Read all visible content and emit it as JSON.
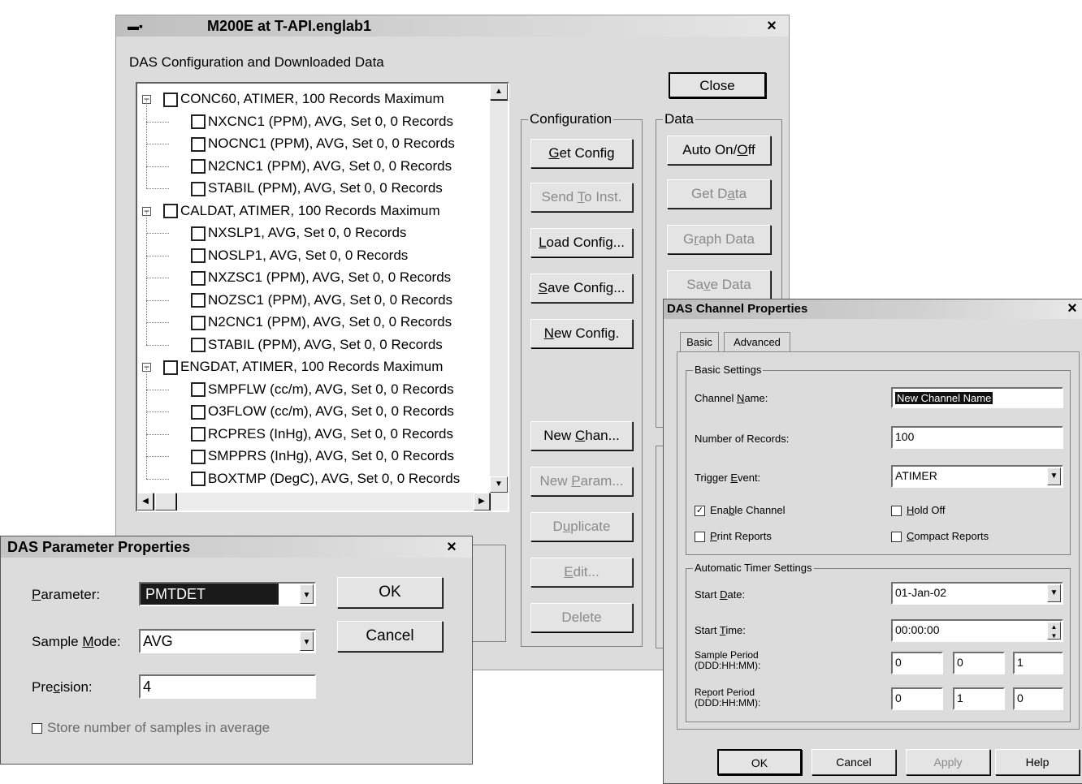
{
  "main": {
    "title": "M200E  at T-API.englab1",
    "subtitle": "DAS Configuration and Downloaded Data",
    "close_x": "×",
    "close_label": "Close",
    "tree": [
      {
        "label": "CONC60, ATIMER, 100 Records Maximum",
        "level": 0
      },
      {
        "label": "NXCNC1 (PPM), AVG, Set 0, 0 Records",
        "level": 1
      },
      {
        "label": "NOCNC1 (PPM), AVG, Set 0, 0 Records",
        "level": 1
      },
      {
        "label": "N2CNC1 (PPM), AVG, Set 0, 0 Records",
        "level": 1
      },
      {
        "label": "STABIL (PPM), AVG, Set 0, 0 Records",
        "level": 1
      },
      {
        "label": "CALDAT, ATIMER, 100 Records Maximum",
        "level": 0
      },
      {
        "label": "NXSLP1, AVG, Set 0, 0 Records",
        "level": 1
      },
      {
        "label": "NOSLP1, AVG, Set 0, 0 Records",
        "level": 1
      },
      {
        "label": "NXZSC1 (PPM), AVG, Set 0, 0 Records",
        "level": 1
      },
      {
        "label": "NOZSC1 (PPM), AVG, Set 0, 0 Records",
        "level": 1
      },
      {
        "label": "N2CNC1 (PPM), AVG, Set 0, 0 Records",
        "level": 1
      },
      {
        "label": "STABIL (PPM), AVG, Set 0, 0 Records",
        "level": 1
      },
      {
        "label": "ENGDAT, ATIMER, 100 Records Maximum",
        "level": 0
      },
      {
        "label": "SMPFLW (cc/m), AVG, Set 0, 0 Records",
        "level": 1
      },
      {
        "label": "O3FLOW (cc/m), AVG, Set 0, 0 Records",
        "level": 1
      },
      {
        "label": "RCPRES (InHg), AVG, Set 0, 0 Records",
        "level": 1
      },
      {
        "label": "SMPPRS (InHg), AVG, Set 0, 0 Records",
        "level": 1
      },
      {
        "label": "BOXTMP (DegC), AVG, Set 0, 0 Records",
        "level": 1
      }
    ],
    "configuration": {
      "label": "Configuration",
      "get_config": "Get Config",
      "send_to_inst": "Send To Inst.",
      "load_config": "Load Config...",
      "save_config": "Save Config...",
      "new_config": "New Config.",
      "new_chan": "New Chan...",
      "new_param": "New Param...",
      "duplicate": "Duplicate",
      "edit": "Edit...",
      "delete": "Delete"
    },
    "data": {
      "label": "Data",
      "auto_onoff": "Auto On/Off",
      "get_data": "Get Data",
      "graph_data": "Graph Data",
      "save_data": "Save Data"
    }
  },
  "param_dialog": {
    "title": "DAS Parameter Properties",
    "close_x": "×",
    "parameter_label": "Parameter:",
    "parameter_value": "PMTDET",
    "sample_mode_label": "Sample Mode:",
    "sample_mode_value": "AVG",
    "precision_label": "Precision:",
    "precision_value": "4",
    "store_samples_label": "Store number of samples in average",
    "ok": "OK",
    "cancel": "Cancel"
  },
  "channel_dialog": {
    "title": "DAS Channel Properties",
    "close_x": "×",
    "tabs": [
      "Basic",
      "Advanced"
    ],
    "basic_settings_label": "Basic Settings",
    "channel_name_label": "Channel Name:",
    "channel_name_value": "New Channel Name",
    "num_records_label": "Number of Records:",
    "num_records_value": "100",
    "trigger_event_label": "Trigger Event:",
    "trigger_event_value": "ATIMER",
    "enable_channel_label": "Enable Channel",
    "enable_channel_checked": true,
    "hold_off_label": "Hold Off",
    "print_reports_label": "Print Reports",
    "compact_reports_label": "Compact Reports",
    "timer_settings_label": "Automatic Timer Settings",
    "start_date_label": "Start Date:",
    "start_date_value": "01-Jan-02",
    "start_time_label": "Start Time:",
    "start_time_value": "00:00:00",
    "sample_period_label_1": "Sample Period",
    "sample_period_label_2": "(DDD:HH:MM):",
    "sample_period_values": [
      "0",
      "0",
      "1"
    ],
    "report_period_label_1": "Report Period",
    "report_period_label_2": "(DDD:HH:MM):",
    "report_period_values": [
      "0",
      "1",
      "0"
    ],
    "ok": "OK",
    "cancel": "Cancel",
    "apply": "Apply",
    "help": "Help"
  }
}
